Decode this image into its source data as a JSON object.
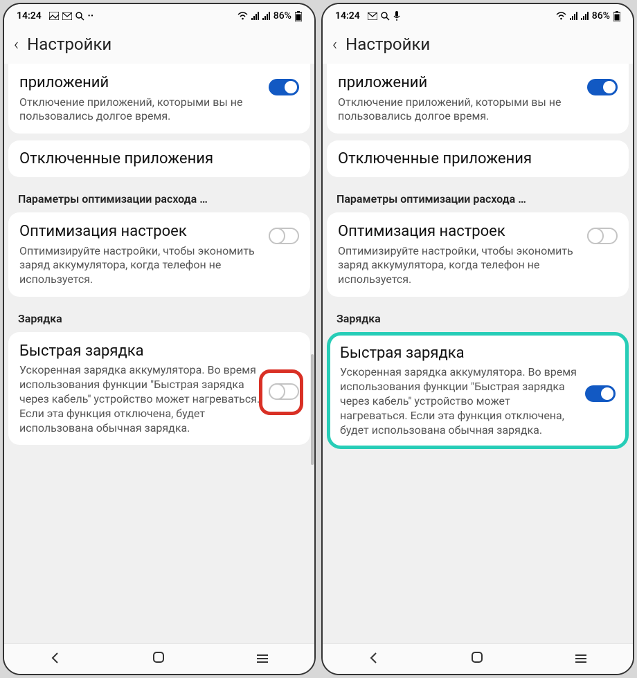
{
  "left": {
    "status": {
      "time": "14:24",
      "battery": "86%"
    },
    "header": {
      "title": "Настройки"
    },
    "apps": {
      "title": "приложений",
      "desc": "Отключение приложений, которыми вы не пользовались долгое время.",
      "toggle": true
    },
    "disabled_apps": {
      "title": "Отключенные приложения"
    },
    "section_opt": "Параметры оптимизации расхода …",
    "optimize": {
      "title": "Оптимизация настроек",
      "desc": "Оптимизируйте настройки, чтобы экономить заряд аккумулятора, когда телефон не используется.",
      "toggle": false
    },
    "section_charge": "Зарядка",
    "fast": {
      "title": "Быстрая зарядка",
      "desc": "Ускоренная зарядка аккумулятора. Во время использования функции \"Быстрая зарядка через кабель\" устройство может нагреваться. Если эта функция отключена, будет использована обычная зарядка.",
      "toggle": false
    }
  },
  "right": {
    "status": {
      "time": "14:24",
      "battery": "86%"
    },
    "header": {
      "title": "Настройки"
    },
    "apps": {
      "title": "приложений",
      "desc": "Отключение приложений, которыми вы не пользовались долгое время.",
      "toggle": true
    },
    "disabled_apps": {
      "title": "Отключенные приложения"
    },
    "section_opt": "Параметры оптимизации расхода …",
    "optimize": {
      "title": "Оптимизация настроек",
      "desc": "Оптимизируйте настройки, чтобы экономить заряд аккумулятора, когда телефон не используется.",
      "toggle": false
    },
    "section_charge": "Зарядка",
    "fast": {
      "title": "Быстрая зарядка",
      "desc": "Ускоренная зарядка аккумулятора. Во время использования функции \"Быстрая зарядка через кабель\" устройство может нагреваться. Если эта функция отключена, будет использована обычная зарядка.",
      "toggle": true
    }
  }
}
